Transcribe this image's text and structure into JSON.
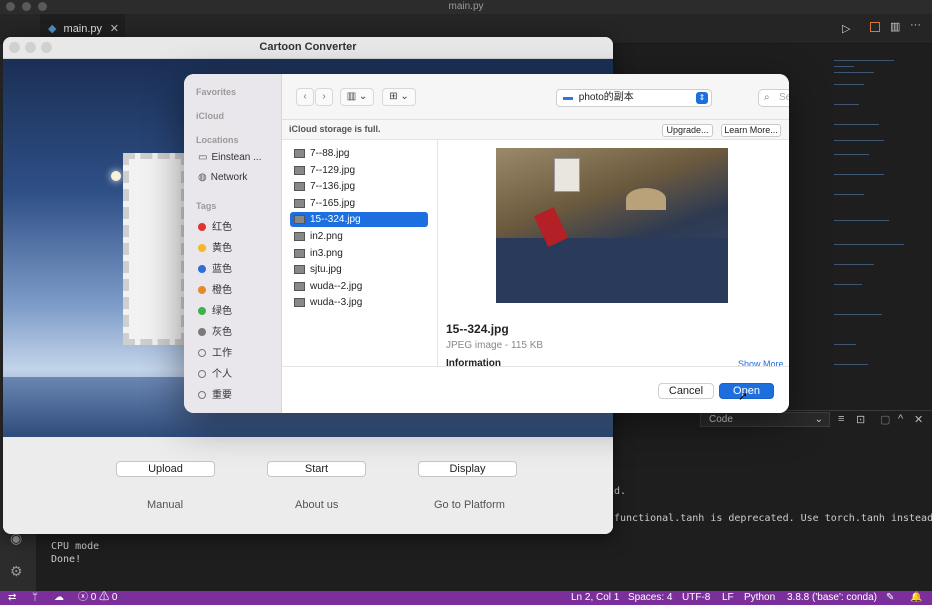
{
  "vscode": {
    "window_title": "main.py",
    "tab_label": "main.py",
    "panel_select": "Code",
    "terminal_lines": [
      "d.",
      "functional.tanh is deprecated. Use torch.tanh instead.",
      "CPU mode",
      "Done!"
    ],
    "status": {
      "errors": "0",
      "warnings": "0",
      "position": "Ln 2, Col 1",
      "spaces": "Spaces: 4",
      "encoding": "UTF-8",
      "eol": "LF",
      "language": "Python",
      "interpreter": "3.8.8 ('base': conda)"
    }
  },
  "app": {
    "title": "Cartoon Converter",
    "buttons": {
      "upload": "Upload",
      "start": "Start",
      "display": "Display"
    },
    "links": {
      "manual": "Manual",
      "about": "About us",
      "platform": "Go to Platform"
    }
  },
  "dialog": {
    "sidebar": {
      "favorites_header": "Favorites",
      "icloud_header": "iCloud",
      "locations_header": "Locations",
      "locations": [
        {
          "label": "Einstean ...",
          "icon": "laptop-icon"
        },
        {
          "label": "Network",
          "icon": "network-icon"
        }
      ],
      "tags_header": "Tags",
      "tags": [
        {
          "label": "红色",
          "color": "#e0342f",
          "filled": true
        },
        {
          "label": "黄色",
          "color": "#f3b82a",
          "filled": true
        },
        {
          "label": "蓝色",
          "color": "#2d6fd6",
          "filled": true
        },
        {
          "label": "橙色",
          "color": "#e58b24",
          "filled": true
        },
        {
          "label": "绿色",
          "color": "#3ab44a",
          "filled": true
        },
        {
          "label": "灰色",
          "color": "#7a7a7a",
          "filled": true
        },
        {
          "label": "工作",
          "color": "#7a7a7a",
          "filled": false
        },
        {
          "label": "个人",
          "color": "#7a7a7a",
          "filled": false
        },
        {
          "label": "重要",
          "color": "#7a7a7a",
          "filled": false
        }
      ]
    },
    "path": "photo的副本",
    "search_placeholder": "Search",
    "icloud_message": "iCloud storage is full.",
    "upgrade_label": "Upgrade...",
    "learn_more_label": "Learn More...",
    "files": [
      {
        "name": "7--88.jpg",
        "selected": false
      },
      {
        "name": "7--129.jpg",
        "selected": false
      },
      {
        "name": "7--136.jpg",
        "selected": false
      },
      {
        "name": "7--165.jpg",
        "selected": false
      },
      {
        "name": "15--324.jpg",
        "selected": true
      },
      {
        "name": "in2.png",
        "selected": false
      },
      {
        "name": "in3.png",
        "selected": false
      },
      {
        "name": "sjtu.jpg",
        "selected": false
      },
      {
        "name": "wuda--2.jpg",
        "selected": false
      },
      {
        "name": "wuda--3.jpg",
        "selected": false
      }
    ],
    "preview": {
      "filename": "15--324.jpg",
      "kind": "JPEG image - 115 KB",
      "info_header": "Information",
      "show_more": "Show More"
    },
    "cancel_label": "Cancel",
    "open_label": "Open",
    "accent": "#1d6fe0"
  }
}
